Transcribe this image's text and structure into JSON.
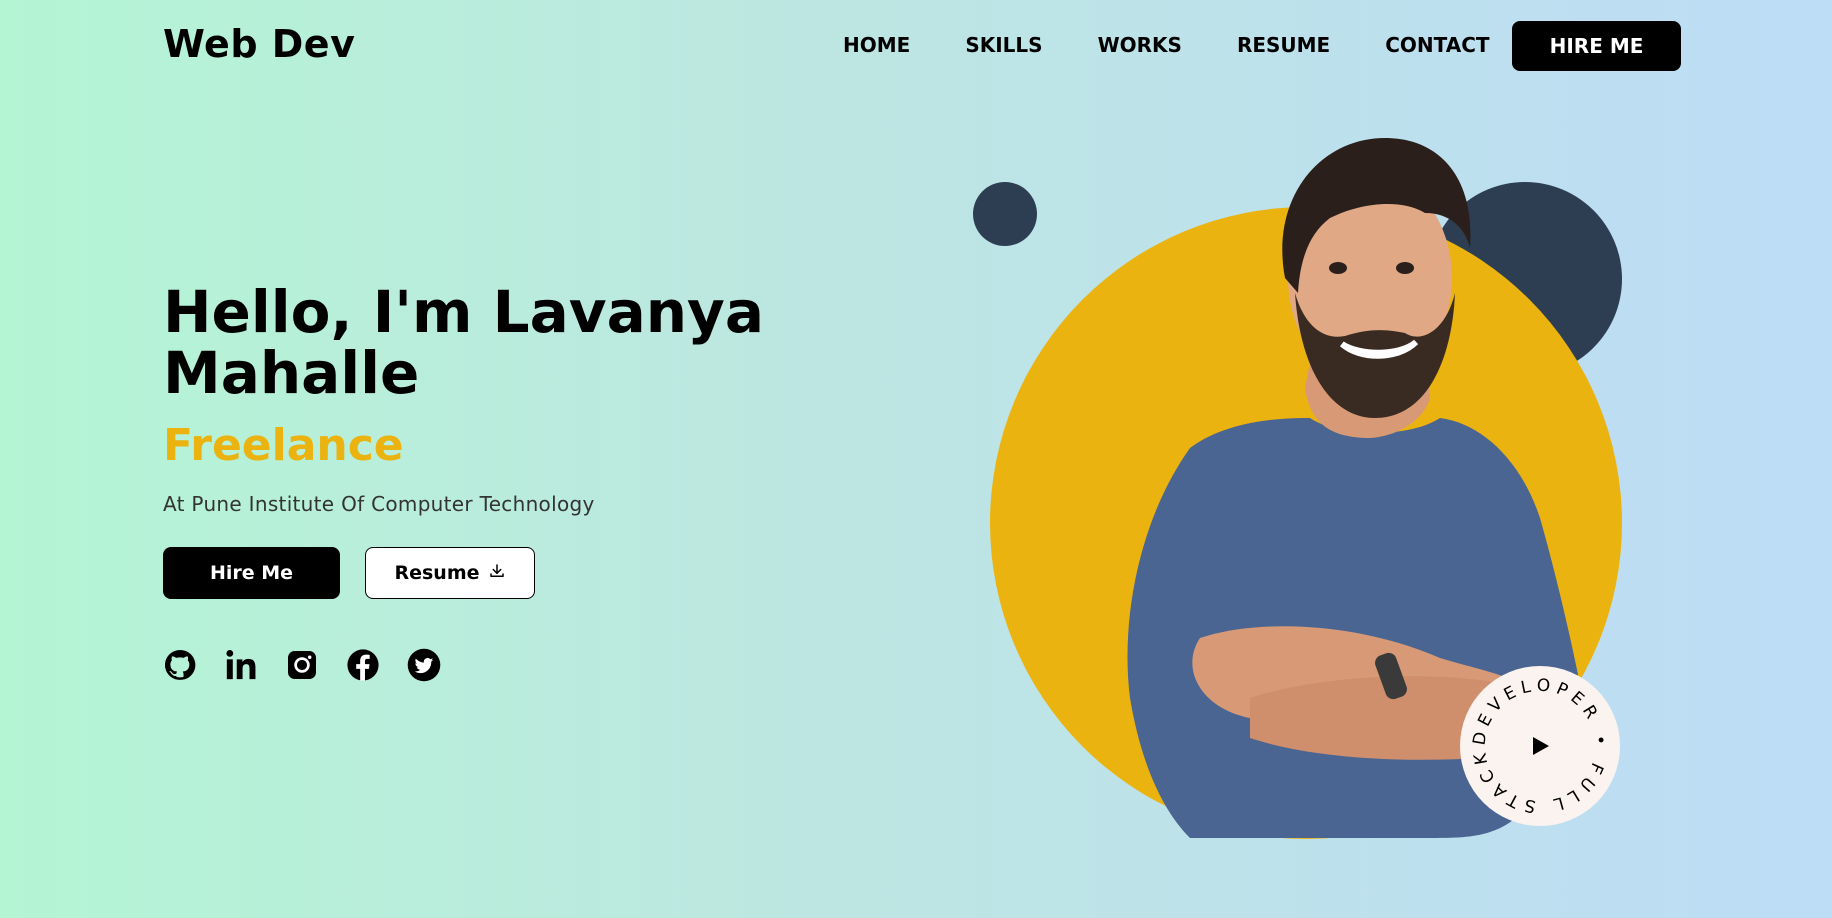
{
  "nav": {
    "logo": "Web Dev",
    "links": [
      "HOME",
      "SKILLS",
      "WORKS",
      "RESUME",
      "CONTACT"
    ],
    "hire_label": "HIRE ME"
  },
  "hero": {
    "title": "Hello, I'm Lavanya Mahalle",
    "role": "Freelance",
    "description": "At Pune Institute Of Computer Technology",
    "hire_label": "Hire Me",
    "resume_label": "Resume"
  },
  "socials": [
    {
      "icon": "github-icon"
    },
    {
      "icon": "linkedin-icon"
    },
    {
      "icon": "instagram-icon"
    },
    {
      "icon": "facebook-icon"
    },
    {
      "icon": "twitter-icon"
    }
  ],
  "badge": {
    "text": "DEVELOPER • FULL STACK "
  },
  "colors": {
    "accent": "#ebb30f",
    "dark": "#2d3e53",
    "shirt": "#4a6591"
  }
}
